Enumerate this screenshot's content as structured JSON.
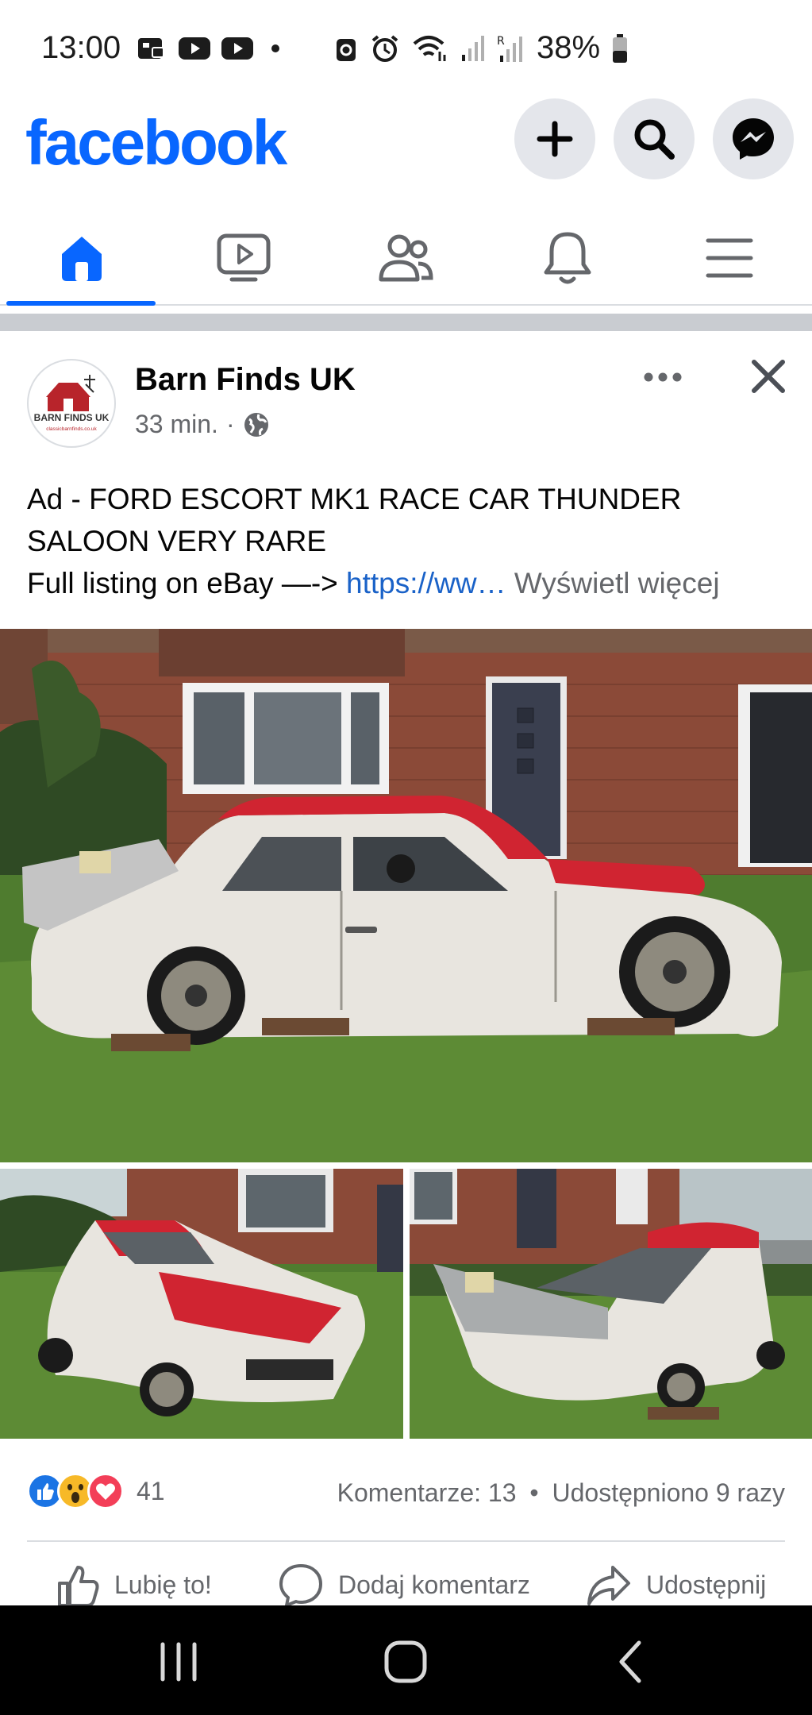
{
  "status_bar": {
    "time": "13:00",
    "battery": "38%",
    "icons": [
      "gallery-icon",
      "youtube-icon",
      "youtube-icon",
      "dot-icon",
      "recycle-icon",
      "alarm-icon",
      "wifi-icon",
      "signal-icon",
      "signal-roaming-icon",
      "battery-icon"
    ]
  },
  "header": {
    "logo": "facebook",
    "buttons": [
      "plus-icon",
      "search-icon",
      "messenger-icon"
    ]
  },
  "tabs": [
    {
      "name": "home",
      "icon": "home-icon",
      "active": true
    },
    {
      "name": "video",
      "icon": "video-icon",
      "active": false
    },
    {
      "name": "friends",
      "icon": "friends-icon",
      "active": false
    },
    {
      "name": "notifications",
      "icon": "bell-icon",
      "active": false
    },
    {
      "name": "menu",
      "icon": "menu-icon",
      "active": false
    }
  ],
  "post": {
    "page_name": "Barn Finds UK",
    "time": "33 min.",
    "separator": "·",
    "avatar_text": "BARN FINDS UK",
    "avatar_subtext": "classicbarnfinds.co.uk",
    "text_line1": "Ad - FORD ESCORT MK1 RACE CAR THUNDER SALOON VERY RARE",
    "text_line2_prefix": "Full listing on eBay —-> ",
    "text_link": "https://ww…",
    "see_more": "Wyświetl więcej",
    "reactions_count": "41",
    "comments": "Komentarze: 13",
    "bullet": "•",
    "shares": "Udostępniono 9 razy",
    "like_label": "Lubię to!",
    "comment_label": "Dodaj komentarz",
    "share_label": "Udostępnij"
  },
  "colors": {
    "brand": "#0866ff",
    "secondary_text": "#65676b",
    "link": "#1a62c8",
    "separator": "#c9ccd1"
  }
}
